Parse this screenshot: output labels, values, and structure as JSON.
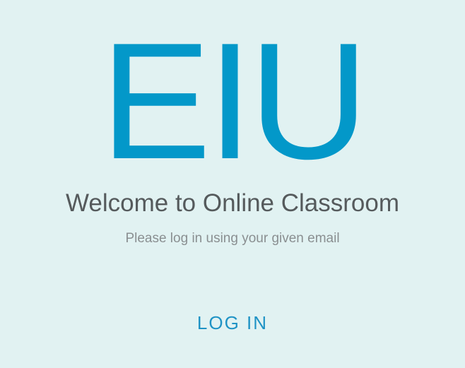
{
  "logo": {
    "text": "EIU",
    "color": "#0398c9"
  },
  "welcome": {
    "title": "Welcome to Online Classroom",
    "subtitle": "Please log in using your given email"
  },
  "actions": {
    "login_label": "LOG IN",
    "login_color": "#1f93c5"
  },
  "theme": {
    "background": "#e1f2f2",
    "title_color": "#555a5c",
    "subtitle_color": "#8a8f91"
  }
}
